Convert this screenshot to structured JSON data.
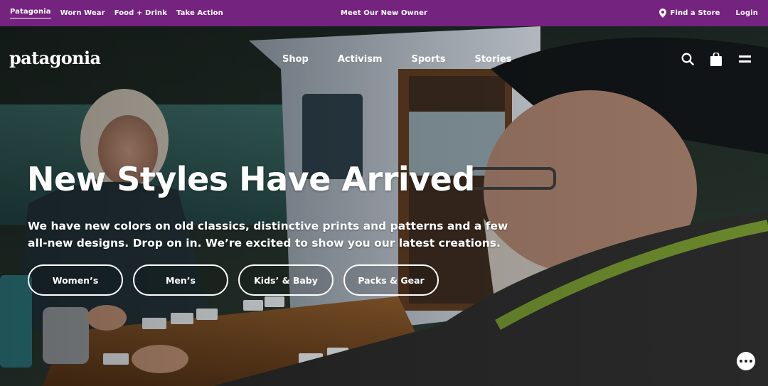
{
  "topbar": {
    "links": [
      "Patagonia",
      "Worn Wear",
      "Food + Drink",
      "Take Action"
    ],
    "announcement": "Meet Our New Owner",
    "find_store": "Find a Store",
    "login": "Login",
    "background": "#74237f"
  },
  "nav": {
    "logo": "patagonia",
    "links": [
      "Shop",
      "Activism",
      "Sports",
      "Stories"
    ],
    "icons": [
      "search-icon",
      "bag-icon",
      "menu-icon"
    ]
  },
  "hero": {
    "headline": "New Styles Have Arrived",
    "subtext": "We have new colors on old classics, distinctive prints and patterns and a few all-new designs. Drop on in. We’re excited to show you our latest creations.",
    "ctas": [
      "Women’s",
      "Men’s",
      "Kids’ & Baby",
      "Packs & Gear"
    ]
  },
  "chat": {
    "icon": "chat-ellipsis-icon"
  }
}
